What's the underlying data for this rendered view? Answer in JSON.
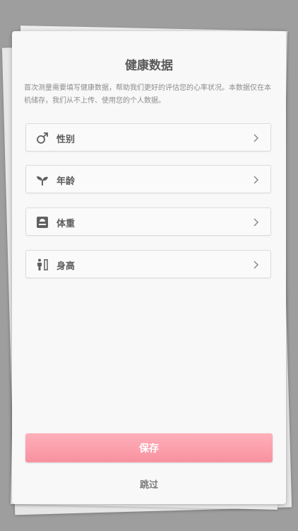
{
  "dialog": {
    "title": "健康数据",
    "description": "首次测量需要填写健康数据，帮助我们更好的评估您的心率状况。本数据仅在本机储存，我们从不上传、使用您的个人数据。"
  },
  "fields": [
    {
      "label": "性别",
      "icon": "male-icon"
    },
    {
      "label": "年龄",
      "icon": "sprout-icon"
    },
    {
      "label": "体重",
      "icon": "scale-icon"
    },
    {
      "label": "身高",
      "icon": "height-measure-icon"
    }
  ],
  "actions": {
    "save_label": "保存",
    "skip_label": "跳过"
  },
  "colors": {
    "accent": "#f8919f",
    "text": "#5c5c5c"
  }
}
